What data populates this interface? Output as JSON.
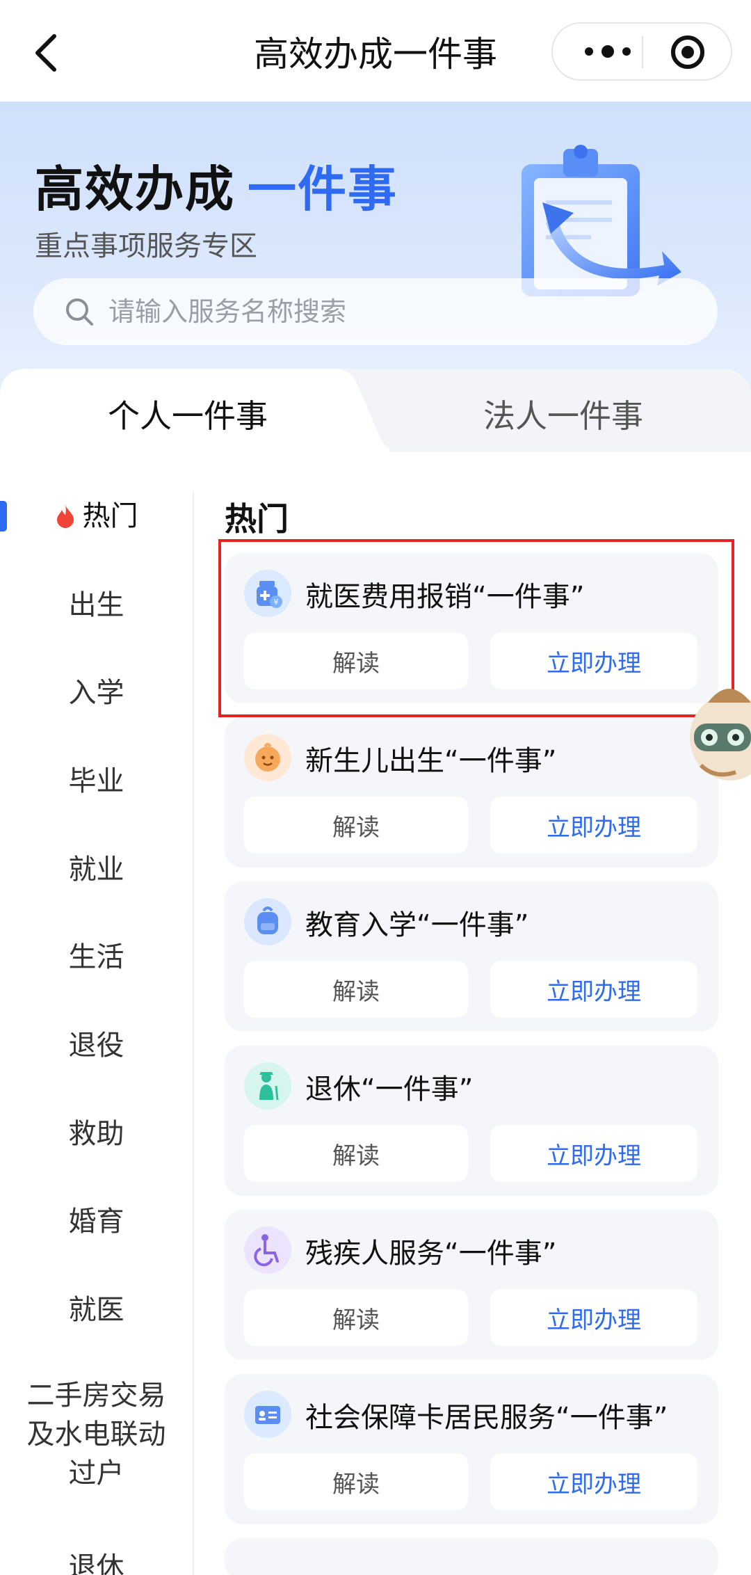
{
  "nav": {
    "title": "高效办成一件事",
    "back_icon": "chevron-left-icon",
    "more_icon": "more-dots-icon",
    "close_icon": "target-icon"
  },
  "hero": {
    "title_main": "高效办成",
    "title_accent": "一件事",
    "subtitle": "重点事项服务专区",
    "search_placeholder": "请输入服务名称搜索"
  },
  "tabs": [
    {
      "label": "个人一件事",
      "active": true
    },
    {
      "label": "法人一件事",
      "active": false
    }
  ],
  "sidebar": {
    "items": [
      {
        "label": "热门",
        "active": true,
        "icon": "flame-icon"
      },
      {
        "label": "出生"
      },
      {
        "label": "入学"
      },
      {
        "label": "毕业"
      },
      {
        "label": "就业"
      },
      {
        "label": "生活"
      },
      {
        "label": "退役"
      },
      {
        "label": "救助"
      },
      {
        "label": "婚育"
      },
      {
        "label": "就医"
      },
      {
        "label": "二手房交易及水电联动过户"
      },
      {
        "label": "退休"
      }
    ],
    "second_hand_lines": [
      "二手房交易",
      "及水电联动",
      "过户"
    ]
  },
  "section": {
    "title": "热门"
  },
  "cards": [
    {
      "title": "就医费用报销“一件事”",
      "read_label": "解读",
      "go_label": "立即办理",
      "icon": "medical-reimbursement-icon",
      "icon_color": "#dbeafe"
    },
    {
      "title": "新生儿出生“一件事”",
      "read_label": "解读",
      "go_label": "立即办理",
      "icon": "baby-icon",
      "icon_color": "#ffe9d6"
    },
    {
      "title": "教育入学“一件事”",
      "read_label": "解读",
      "go_label": "立即办理",
      "icon": "schoolbag-icon",
      "icon_color": "#dbe7ff"
    },
    {
      "title": "退休“一件事”",
      "read_label": "解读",
      "go_label": "立即办理",
      "icon": "retiree-icon",
      "icon_color": "#d6f5ee"
    },
    {
      "title": "残疾人服务“一件事”",
      "read_label": "解读",
      "go_label": "立即办理",
      "icon": "wheelchair-icon",
      "icon_color": "#ece3ff"
    },
    {
      "title": "社会保障卡居民服务“一件事”",
      "read_label": "解读",
      "go_label": "立即办理",
      "icon": "id-card-icon",
      "icon_color": "#dbeafe"
    }
  ],
  "colors": {
    "accent": "#2f6bf2",
    "highlight": "#e82222"
  }
}
